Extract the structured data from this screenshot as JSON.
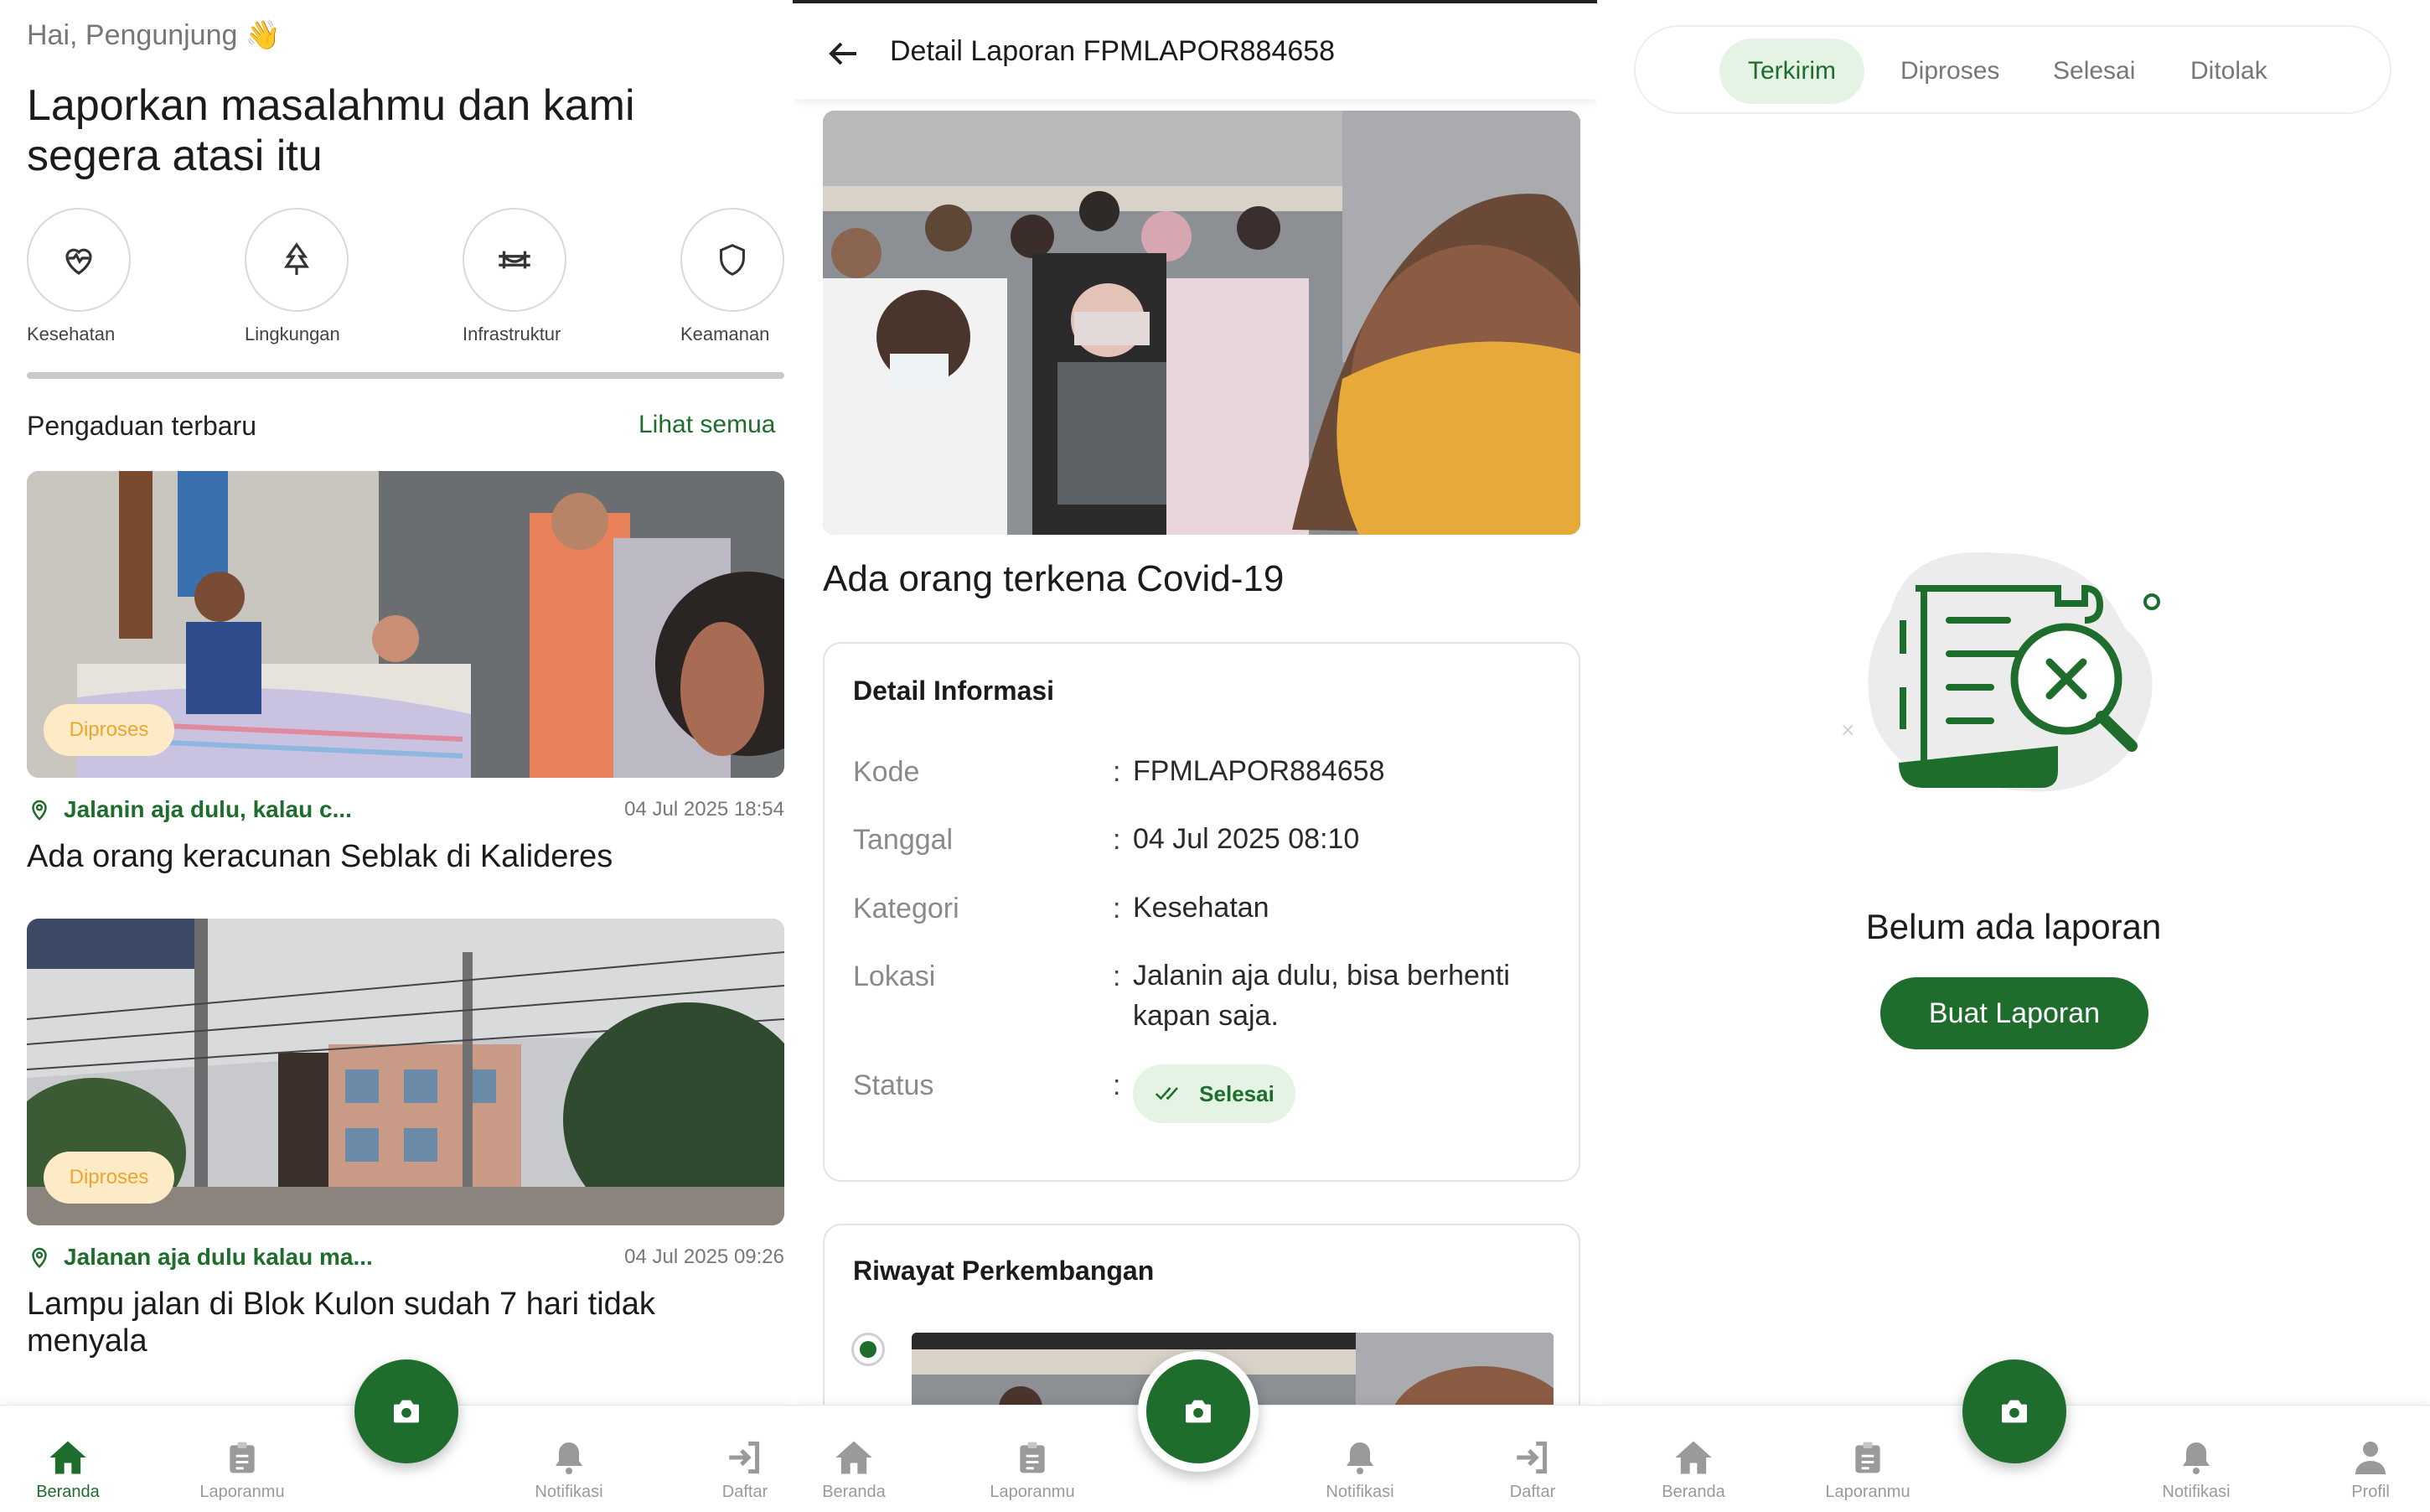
{
  "home": {
    "greeting": "Hai, Pengunjung 👋",
    "headline": "Laporkan masalahmu dan kami segera atasi itu",
    "categories": [
      {
        "label": "Kesehatan",
        "icon": "heart-pulse-icon"
      },
      {
        "label": "Lingkungan",
        "icon": "tree-icon"
      },
      {
        "label": "Infrastruktur",
        "icon": "bridge-icon"
      },
      {
        "label": "Keamanan",
        "icon": "shield-icon"
      }
    ],
    "recent_title": "Pengaduan terbaru",
    "see_all": "Lihat semua",
    "reports": [
      {
        "status": "Diproses",
        "location": "Jalanin aja dulu, kalau c...",
        "timestamp": "04 Jul 2025 18:54",
        "title": "Ada orang keracunan Seblak di Kalideres"
      },
      {
        "status": "Diproses",
        "location": "Jalanan aja dulu kalau ma...",
        "timestamp": "04 Jul 2025 09:26",
        "title": "Lampu jalan di Blok Kulon sudah 7 hari tidak menyala"
      }
    ]
  },
  "nav_home": {
    "items": [
      "Beranda",
      "Laporanmu",
      "Notifikasi",
      "Daftar"
    ]
  },
  "detail": {
    "header_title": "Detail Laporan FPMLAPOR884658",
    "report_title": "Ada orang terkena Covid-19",
    "info_title": "Detail Informasi",
    "separator": ":",
    "fields": [
      {
        "key": "Kode",
        "value": "FPMLAPOR884658"
      },
      {
        "key": "Tanggal",
        "value": "04 Jul 2025 08:10"
      },
      {
        "key": "Kategori",
        "value": "Kesehatan"
      },
      {
        "key": "Lokasi",
        "value": "Jalanin aja dulu, bisa berhenti kapan saja."
      }
    ],
    "status_key": "Status",
    "status_value": "Selesai",
    "history_title": "Riwayat Perkembangan"
  },
  "nav_detail": {
    "items": [
      "Beranda",
      "Laporanmu",
      "Notifikasi",
      "Daftar"
    ]
  },
  "myreports": {
    "tabs": [
      "Terkirim",
      "Diproses",
      "Selesai",
      "Ditolak"
    ],
    "active_tab": "Terkirim",
    "empty_title": "Belum ada laporan",
    "create_button": "Buat Laporan"
  },
  "nav_myreports": {
    "items": [
      "Beranda",
      "Laporanmu",
      "Notifikasi",
      "Profil"
    ]
  },
  "colors": {
    "primary": "#1e6d2c",
    "processing_bg": "#fdebc8",
    "processing_text": "#e9a630",
    "done_bg": "#e4f3e4"
  }
}
